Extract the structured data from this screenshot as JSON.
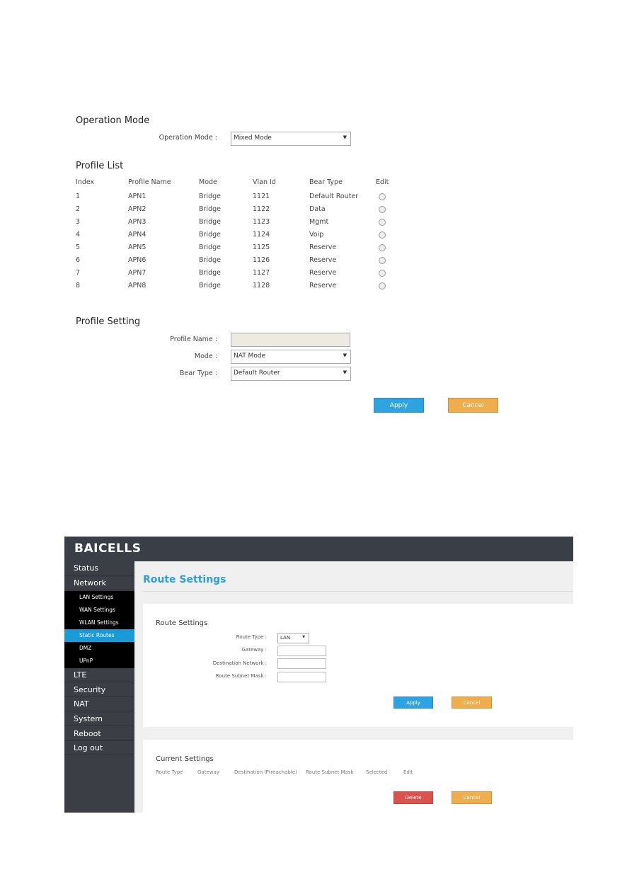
{
  "operation_mode": {
    "heading": "Operation Mode",
    "label": "Operation Mode :",
    "value": "Mixed Mode"
  },
  "profile_list": {
    "heading": "Profile List",
    "columns": [
      "Index",
      "Profile Name",
      "Mode",
      "Vlan Id",
      "Bear Type",
      "Edit"
    ],
    "rows": [
      [
        "1",
        "APN1",
        "Bridge",
        "1121",
        "Default Router"
      ],
      [
        "2",
        "APN2",
        "Bridge",
        "1122",
        "Data"
      ],
      [
        "3",
        "APN3",
        "Bridge",
        "1123",
        "Mgmt"
      ],
      [
        "4",
        "APN4",
        "Bridge",
        "1124",
        "Voip"
      ],
      [
        "5",
        "APN5",
        "Bridge",
        "1125",
        "Reserve"
      ],
      [
        "6",
        "APN6",
        "Bridge",
        "1126",
        "Reserve"
      ],
      [
        "7",
        "APN7",
        "Bridge",
        "1127",
        "Reserve"
      ],
      [
        "8",
        "APN8",
        "Bridge",
        "1128",
        "Reserve"
      ]
    ]
  },
  "profile_setting": {
    "heading": "Profile Setting",
    "name_label": "Profile Name :",
    "name_value": "",
    "mode_label": "Mode :",
    "mode_value": "NAT Mode",
    "bear_label": "Bear Type :",
    "bear_value": "Default Router",
    "apply": "Apply",
    "cancel": "Cancel"
  },
  "router": {
    "logo": "BAICELLS",
    "title": "Route Settings",
    "menu": [
      "Status",
      "Network",
      "LTE",
      "Security",
      "NAT",
      "System",
      "Reboot",
      "Log out"
    ],
    "submenu": [
      "LAN Settings",
      "WAN Settings",
      "WLAN Settings",
      "Static Routes",
      "DMZ",
      "UPnP"
    ],
    "active_submenu": "Static Routes",
    "form": {
      "heading": "Route Settings",
      "route_type_label": "Route Type :",
      "route_type_value": "LAN",
      "gateway_label": "Gateway :",
      "dest_label": "Destination Network :",
      "mask_label": "Route Subnet Mask :",
      "apply": "Apply",
      "cancel": "Cancel"
    },
    "current": {
      "heading": "Current Settings",
      "columns": [
        "Route Type",
        "Gateway",
        "Destination IP(reachable)",
        "Route Subnet Mask",
        "Selected",
        "Edit"
      ],
      "delete": "Delete",
      "cancel": "Cancel"
    }
  },
  "colors": {
    "blue": "#2fa3e0",
    "orange": "#f0ad4e",
    "red": "#d9534f",
    "title_blue": "#2d9fd8",
    "active": "#1a9bd7"
  }
}
